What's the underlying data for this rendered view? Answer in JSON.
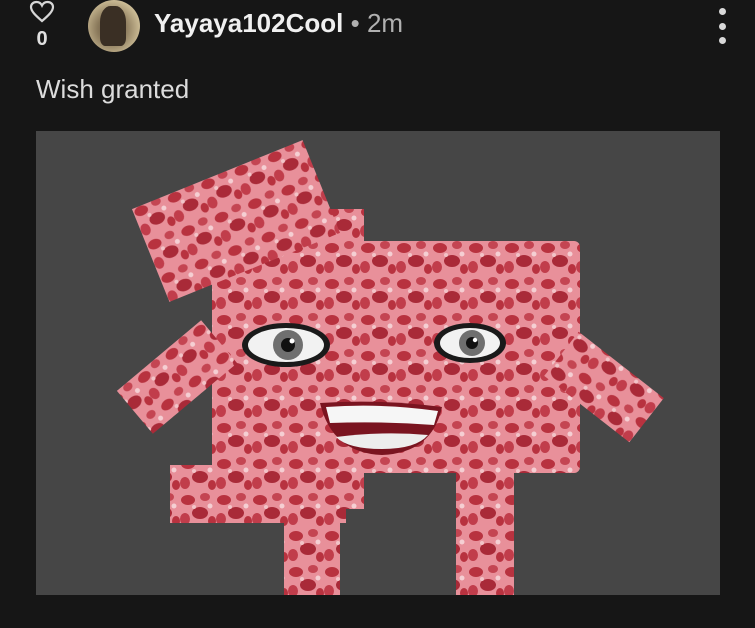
{
  "post": {
    "score": "0",
    "username": "Yayaya102Cool",
    "separator": "•",
    "time_ago": "2m",
    "text": "Wish granted",
    "icons": {
      "like": "heart-outline-icon",
      "menu": "more-vertical-icon"
    }
  },
  "colors": {
    "background": "#161616",
    "image_bg": "#464646",
    "meat": "#d94e5e"
  }
}
